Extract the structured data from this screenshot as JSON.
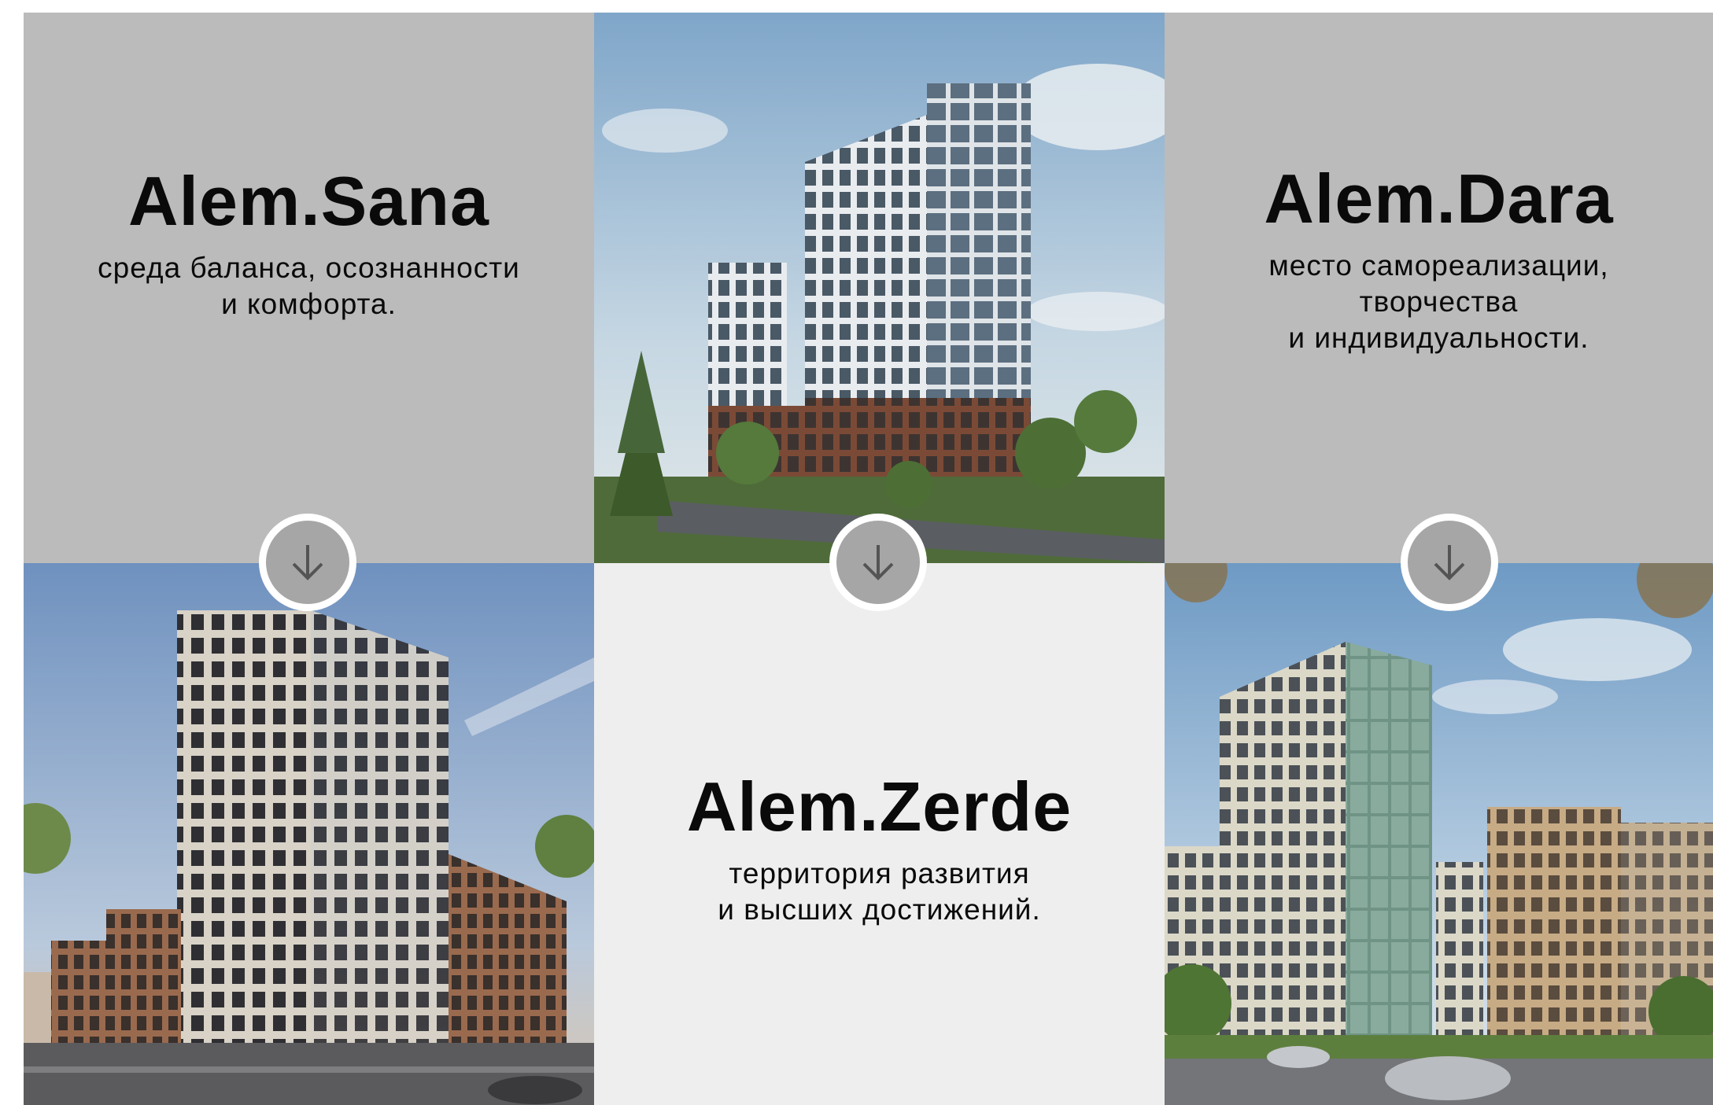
{
  "projects": [
    {
      "title": "Alem.Sana",
      "subtitle_lines": [
        "среда баланса, осознанности",
        "и комфорта."
      ]
    },
    {
      "title": "Alem.Dara",
      "subtitle_lines": [
        "место самореализации,",
        "творчества",
        "и индивидуальности."
      ]
    },
    {
      "title": "Alem.Zerde",
      "subtitle_lines": [
        "территория развития",
        "и высших достижений."
      ]
    }
  ],
  "renders": [
    {
      "icon": "building-render-tall-tower"
    },
    {
      "icon": "building-render-brick-tower"
    },
    {
      "icon": "building-render-green-facade"
    }
  ],
  "controls": {
    "scroll_icon": "arrow-down-icon"
  },
  "colors": {
    "gray_tile": "#bbbbbb",
    "light_tile": "#eeeeee",
    "arrow_fill": "#a6a6a6"
  }
}
